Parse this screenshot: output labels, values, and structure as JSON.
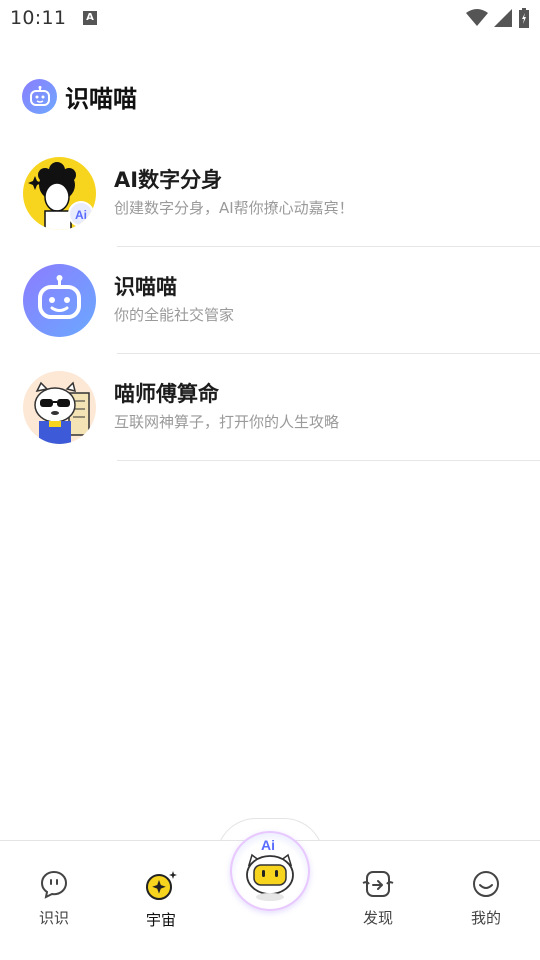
{
  "status_bar": {
    "time": "10:11",
    "notification_glyph": "A"
  },
  "header": {
    "title": "识喵喵",
    "logo_icon": "robot-face-icon"
  },
  "list": [
    {
      "title": "AI数字分身",
      "description": "创建数字分身，AI帮你撩心动嘉宾！",
      "avatar": "ai-digital-avatar",
      "badge": "Ai"
    },
    {
      "title": "识喵喵",
      "description": "你的全能社交管家",
      "avatar": "robot-avatar"
    },
    {
      "title": "喵师傅算命",
      "description": "互联网神算子，打开你的人生攻略",
      "avatar": "cat-fortune-avatar"
    }
  ],
  "tabbar": {
    "tabs": [
      {
        "label": "识识",
        "icon": "chat-bubble-icon"
      },
      {
        "label": "宇宙",
        "icon": "planet-sparkle-icon",
        "active": true
      },
      {
        "label": "发现",
        "icon": "share-box-icon"
      },
      {
        "label": "我的",
        "icon": "smile-face-icon"
      }
    ],
    "center_button": {
      "label": "Ai",
      "icon": "ai-robot-cat-icon"
    }
  },
  "colors": {
    "accent": "#7b8cff",
    "brand_yellow": "#f7d41e",
    "text_primary": "#1c1c1c",
    "text_secondary": "#9a9a9a"
  }
}
